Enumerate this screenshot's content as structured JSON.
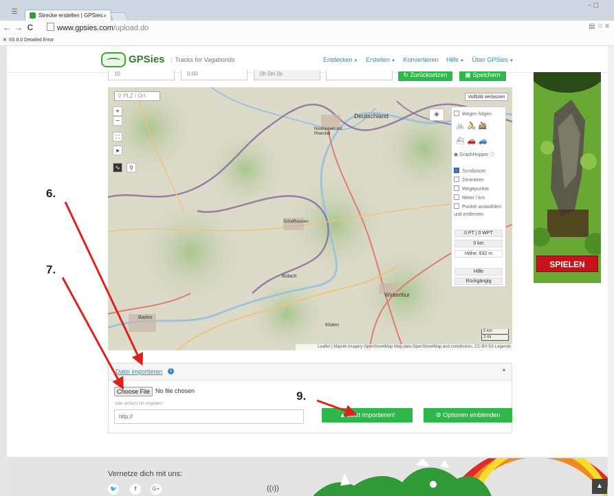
{
  "browser": {
    "tab_title": "Strecke erstellen | GPSies",
    "tab_close": "×",
    "url_host": "www.gpsies.com",
    "url_path": "/upload.do",
    "bookmark": "IIS 8.0 Detailed Error",
    "window_controls": "– ▢"
  },
  "header": {
    "logo_text": "GPSies",
    "tagline_sep": "|",
    "tagline": "Tracks for Vagabonds",
    "nav": [
      {
        "label": "Entdecken"
      },
      {
        "label": "Erstellen"
      },
      {
        "label": "Konvertieren"
      },
      {
        "label": "Hilfe"
      },
      {
        "label": "Über GPSies"
      }
    ]
  },
  "form_row": {
    "field1": "10",
    "field2": "0.00",
    "field3": "0h 0m 0s",
    "field4": "",
    "reset_label": "Zurücksetzen",
    "save_label": "Speichern"
  },
  "map": {
    "search_placeholder": "PLZ / Ort",
    "zoom_in": "+",
    "zoom_out": "−",
    "fullscreen_exit": "Vollbild verlassen",
    "cities": {
      "deutschland": "Deutschland",
      "neuhausen": "Neuhausen am Rheinfall",
      "schaffhausen": "Schaffhausen",
      "bulach": "Bülach",
      "winterthur": "Winterthur",
      "kloten": "Kloten",
      "baden": "Baden"
    },
    "attribution": "Leaflet | Mapnik imagery OpenStreetMap Map data OpenStreetMap and contributors, CC-BY-SA Legende",
    "scale_km": "5 km",
    "scale_mi": "2 mi"
  },
  "route_panel": {
    "follow_roads": "Wegen folgen",
    "router": "GraphHopper",
    "scrollzoom": "Scrollzoom",
    "center": "Zentrieren",
    "waypoints": "Wegepunkte",
    "meter_km": "Meter / km",
    "points_select": "Punkte auswählen und entfernen",
    "pt_count": "0 PT | 0 WPT",
    "distance": "0 km",
    "height": "Höhe: 632 m",
    "help": "Hilfe",
    "undo": "Rückgängig"
  },
  "ad": {
    "play_label": "SPIELEN"
  },
  "import": {
    "title": "Datei importieren",
    "choose_file": "Choose File",
    "no_file": "No file chosen",
    "url_hint": "oder einfach Url eingeben:",
    "url_value": "http://",
    "import_button": "Jetzt importieren!",
    "options_button": "Optionen einblenden"
  },
  "footer": {
    "network_label": "Vernetze dich mit uns:",
    "radio": "((ı))"
  },
  "annotations": {
    "six": "6.",
    "seven": "7.",
    "nine": "9."
  },
  "colors": {
    "accent_green": "#2fb84a",
    "link_blue": "#2b88c9",
    "arrow_red": "#e0201b"
  }
}
